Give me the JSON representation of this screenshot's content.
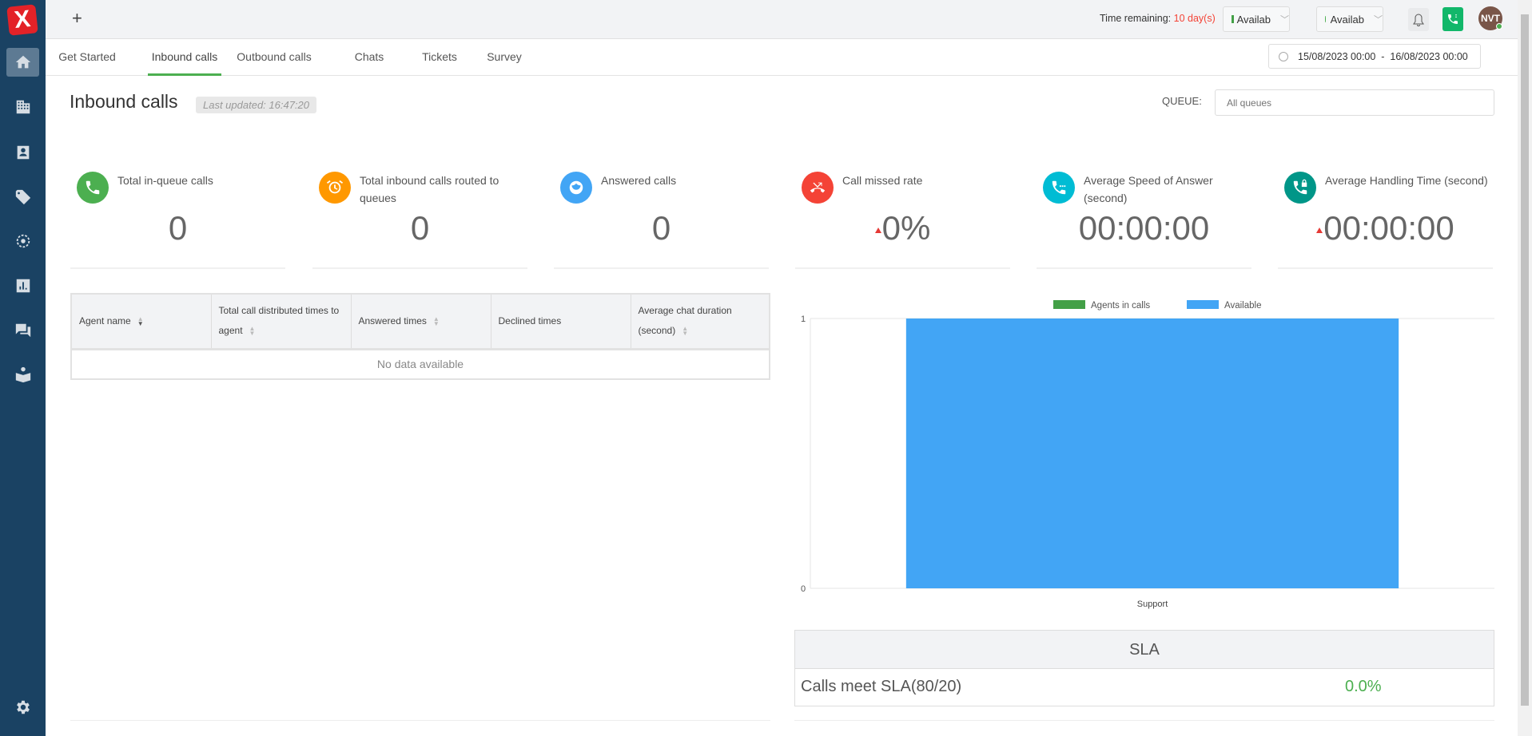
{
  "sidebar": {
    "logo": "X",
    "items": [
      "home",
      "organization",
      "contacts",
      "tags",
      "integrations",
      "reports",
      "chats",
      "knowledge-base"
    ],
    "settings": "settings"
  },
  "topbar": {
    "add": "+",
    "time_remaining_label": "Time remaining:",
    "time_remaining_value": "10 day(s)",
    "chat_status": "Availab",
    "call_status": "Availab",
    "avatar": "NVT"
  },
  "tabs": [
    "Get Started",
    "Inbound calls",
    "Outbound calls",
    "Chats",
    "Tickets",
    "Survey"
  ],
  "date_range": {
    "start": "15/08/2023 00:00",
    "sep": "-",
    "end": "16/08/2023 00:00"
  },
  "page": {
    "title": "Inbound calls",
    "last_updated": "Last updated: 16:47:20",
    "queue_label": "QUEUE:",
    "queue_placeholder": "All queues"
  },
  "cards": [
    {
      "label": "Total in-queue calls",
      "value": "0",
      "color": "#4caf50"
    },
    {
      "label": "Total inbound calls routed to queues",
      "value": "0",
      "color": "#ff9800"
    },
    {
      "label": "Answered calls",
      "value": "0",
      "color": "#42a5f5"
    },
    {
      "label": "Call missed rate",
      "value": "0%",
      "color": "#f44336"
    },
    {
      "label": "Average Speed of Answer (second)",
      "value": "00:00:00",
      "color": "#00bcd4"
    },
    {
      "label": "Average Handling Time (second)",
      "value": "00:00:00",
      "color": "#009688"
    }
  ],
  "table": {
    "headers": [
      "Agent name",
      "Total call distributed times to agent",
      "Answered times",
      "Declined times",
      "Average chat duration (second)"
    ],
    "empty": "No data available"
  },
  "chart_data": {
    "type": "bar",
    "categories": [
      "Support"
    ],
    "series": [
      {
        "name": "Agents in calls",
        "values": [
          0
        ],
        "color": "#43a047"
      },
      {
        "name": "Available",
        "values": [
          1
        ],
        "color": "#42a5f5"
      }
    ],
    "ylim": [
      0,
      1
    ],
    "yticks": [
      "0",
      "1"
    ],
    "legend": "top-center",
    "stacked": true
  },
  "sla": {
    "title": "SLA",
    "row_label": "Calls meet SLA(80/20)",
    "row_value": "0.0%"
  }
}
